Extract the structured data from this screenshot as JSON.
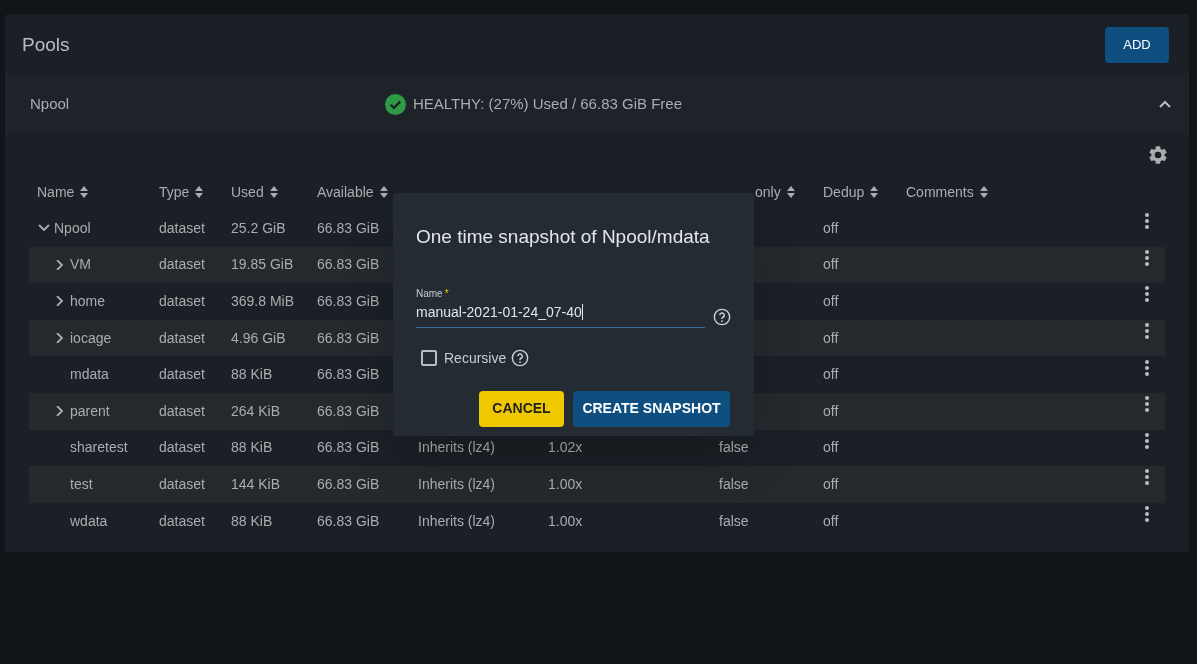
{
  "page_title": "Pools",
  "add_button": "ADD",
  "pool": {
    "name": "Npool",
    "status": "HEALTHY: (27%) Used / 66.83 GiB Free",
    "healthy": true,
    "expanded": true
  },
  "table": {
    "columns": [
      "Name",
      "Type",
      "Used",
      "Available",
      "only",
      "Dedup",
      "Comments"
    ],
    "rows": [
      {
        "name": "Npool",
        "kind": "branch",
        "expanded": true,
        "type": "dataset",
        "used": "25.2 GiB",
        "available": "66.83 GiB",
        "dedup": "off",
        "children": [
          {
            "name": "VM",
            "kind": "branch",
            "expanded": false,
            "type": "dataset",
            "used": "19.85 GiB",
            "available": "66.83 GiB",
            "dedup": "off"
          },
          {
            "name": "home",
            "kind": "branch",
            "expanded": false,
            "type": "dataset",
            "used": "369.8 MiB",
            "available": "66.83 GiB",
            "dedup": "off"
          },
          {
            "name": "iocage",
            "kind": "branch",
            "expanded": false,
            "type": "dataset",
            "used": "4.96 GiB",
            "available": "66.83 GiB",
            "dedup": "off"
          },
          {
            "name": "mdata",
            "kind": "leaf",
            "type": "dataset",
            "used": "88 KiB",
            "available": "66.83 GiB",
            "dedup": "off"
          },
          {
            "name": "parent",
            "kind": "branch",
            "expanded": false,
            "type": "dataset",
            "used": "264 KiB",
            "available": "66.83 GiB",
            "dedup": "off"
          },
          {
            "name": "sharetest",
            "kind": "leaf",
            "type": "dataset",
            "used": "88 KiB",
            "available": "66.83 GiB",
            "compression": "Inherits (lz4)",
            "ratio": "1.02x",
            "readonly": "false",
            "dedup": "off"
          },
          {
            "name": "test",
            "kind": "leaf",
            "type": "dataset",
            "used": "144 KiB",
            "available": "66.83 GiB",
            "compression": "Inherits (lz4)",
            "ratio": "1.00x",
            "readonly": "false",
            "dedup": "off"
          },
          {
            "name": "wdata",
            "kind": "leaf",
            "type": "dataset",
            "used": "88 KiB",
            "available": "66.83 GiB",
            "compression": "Inherits (lz4)",
            "ratio": "1.00x",
            "readonly": "false",
            "dedup": "off"
          }
        ]
      }
    ]
  },
  "dialog": {
    "title": "One time snapshot of Npool/mdata",
    "field_label": "Name",
    "required_mark": "*",
    "field_value": "manual-2021-01-24_07-40",
    "recursive_label": "Recursive",
    "recursive_checked": false,
    "buttons": [
      "CANCEL",
      "CREATE SNAPSHOT"
    ]
  }
}
